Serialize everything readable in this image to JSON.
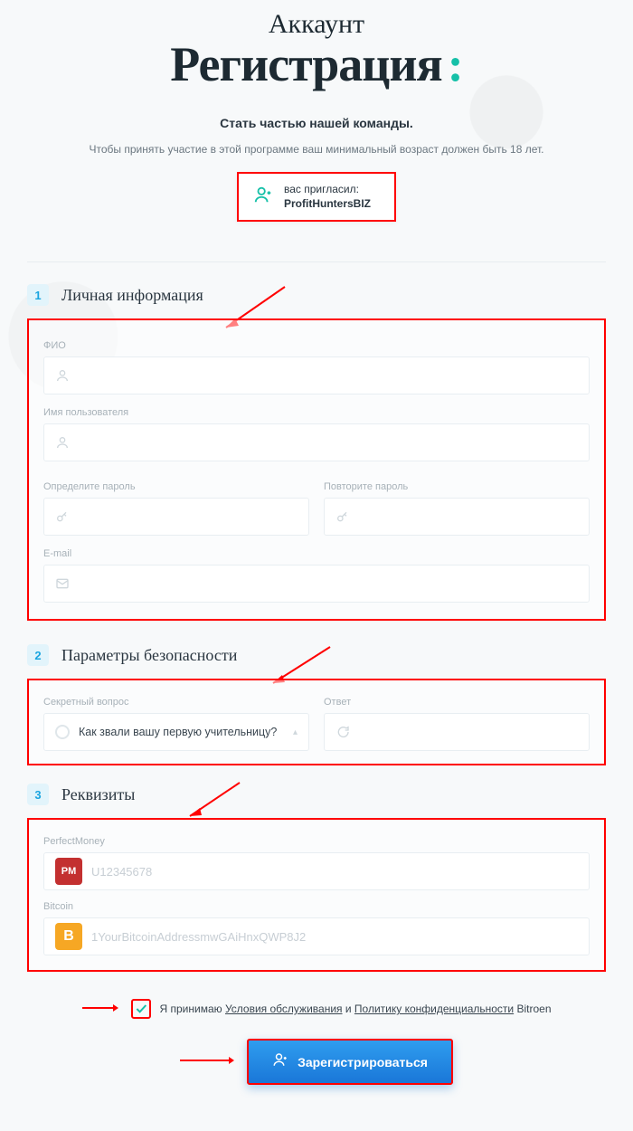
{
  "hero": {
    "pretitle": "Аккаунт",
    "title": "Регистрация",
    "accent": ":",
    "subtitle": "Стать частью нашей команды.",
    "ptext": "Чтобы принять участие в этой программе ваш минимальный возраст должен быть 18 лет."
  },
  "inviter": {
    "label": "вас пригласил:",
    "name": "ProfitHuntersBIZ"
  },
  "sections": {
    "s1": {
      "num": "1",
      "title": "Личная информация"
    },
    "s2": {
      "num": "2",
      "title": "Параметры безопасности"
    },
    "s3": {
      "num": "3",
      "title": "Реквизиты"
    }
  },
  "fields": {
    "fio": {
      "label": "ФИО",
      "value": ""
    },
    "username": {
      "label": "Имя пользователя",
      "value": ""
    },
    "password": {
      "label": "Определите пароль",
      "value": ""
    },
    "password2": {
      "label": "Повторите пароль",
      "value": ""
    },
    "email": {
      "label": "E-mail",
      "value": ""
    },
    "secret_q": {
      "label": "Секретный вопрос",
      "selected": "Как звали вашу первую учительницу?"
    },
    "answer": {
      "label": "Ответ",
      "value": ""
    },
    "pm": {
      "label": "PerfectMoney",
      "placeholder": "U12345678",
      "brand": "PM"
    },
    "btc": {
      "label": "Bitcoin",
      "placeholder": "1YourBitcoinAddressmwGAiHnxQWP8J2",
      "brand": "B"
    }
  },
  "agree": {
    "pre": "Я принимаю ",
    "tos": "Условия обслуживания",
    "mid": " и ",
    "privacy": "Политику конфиденциальности",
    "post": " Bitroen"
  },
  "submit": {
    "label": "Зарегистрироваться"
  }
}
